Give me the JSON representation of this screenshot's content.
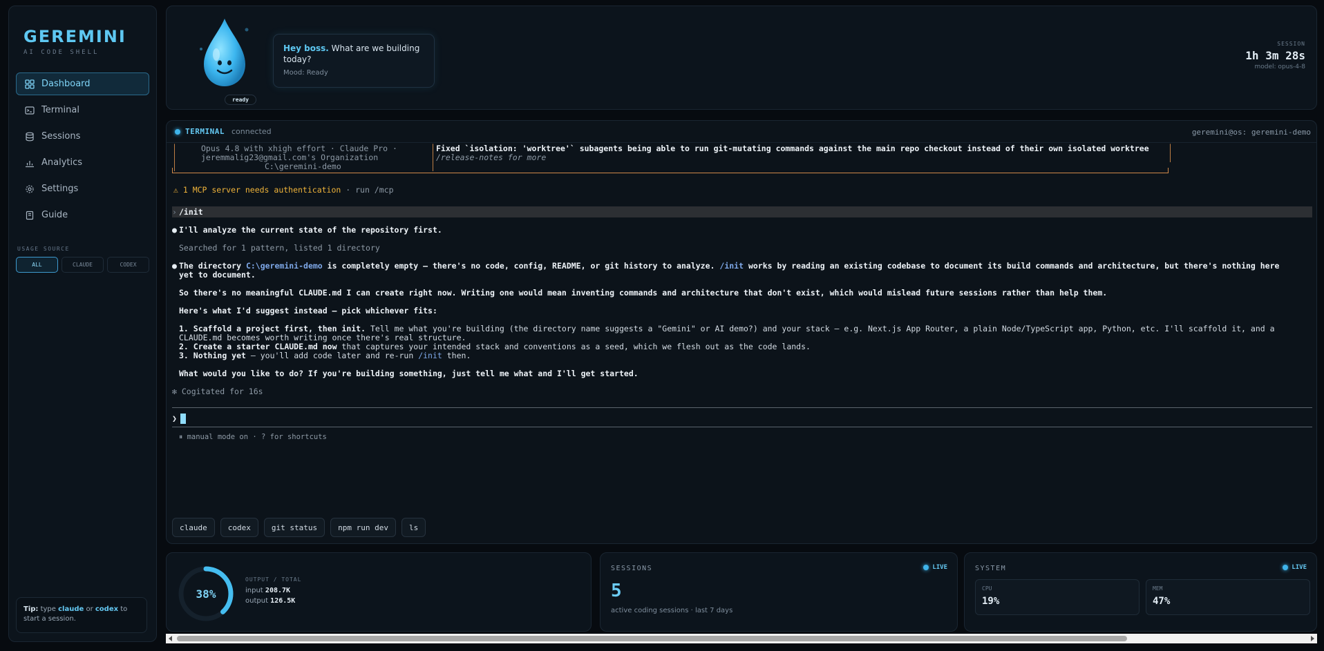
{
  "sidebar": {
    "brand": "GEREMINI",
    "brand_sub": "AI CODE SHELL",
    "items": [
      {
        "label": "Dashboard",
        "icon": "grid-icon",
        "active": true
      },
      {
        "label": "Terminal",
        "icon": "terminal-icon"
      },
      {
        "label": "Sessions",
        "icon": "database-icon"
      },
      {
        "label": "Analytics",
        "icon": "chart-icon"
      },
      {
        "label": "Settings",
        "icon": "gear-icon"
      },
      {
        "label": "Guide",
        "icon": "book-icon"
      }
    ],
    "usage_title": "USAGE SOURCE",
    "usage_options": [
      "ALL",
      "CLAUDE",
      "CODEX"
    ],
    "tip": {
      "prefix": "Tip:",
      "a": " type ",
      "k1": "claude",
      "b": " or ",
      "k2": "codex",
      "c": " to start a session."
    }
  },
  "hero": {
    "badge": "ready",
    "greeting_hi": "Hey boss.",
    "greeting_rest": " What are we building today?",
    "mood": "Mood: Ready",
    "session_label": "SESSION",
    "session_time": "1h 3m 28s",
    "model": "model: opus-4-8"
  },
  "terminal": {
    "title": "TERMINAL",
    "status": "connected",
    "user": "geremini@os: geremini-demo",
    "box_left_1": "Opus 4.8 with xhigh effort · Claude Pro ·",
    "box_left_2": "jeremmalig23@gmail.com's Organization",
    "box_left_3": "C:\\geremini-demo",
    "box_right_1": "Fixed `isolation: 'worktree'` subagents being able to run git-mutating commands against the main repo checkout instead of their own isolated worktree",
    "box_right_2": "/release-notes for more",
    "mcp_warn": "⚠ 1 MCP server needs authentication",
    "mcp_rest": " · run /mcp",
    "cmd": "/init",
    "line1": "I'll analyze the current state of the repository first.",
    "line2": "Searched for 1 pattern, listed 1 directory",
    "line3a": "The directory ",
    "line3b": "C:\\geremini-demo",
    "line3c": " is completely empty — there's no code, config, README, or git history to analyze. ",
    "line3d": "/init",
    "line3e": " works by reading an existing codebase to document its build commands and architecture, but there's nothing here",
    "line3f": "yet to document.",
    "line4": "So there's no meaningful CLAUDE.md I can create right now. Writing one would mean inventing commands and architecture that don't exist, which would mislead future sessions rather than help them.",
    "line5": "Here's what I'd suggest instead — pick whichever fits:",
    "opt1a": "1. ",
    "opt1b": "Scaffold a project first, then init.",
    "opt1c": " Tell me what you're building (the directory name suggests a \"Gemini\" or AI demo?) and your stack — e.g. Next.js App Router, a plain Node/TypeScript app, Python, etc. I'll scaffold it, and a",
    "opt1d": "CLAUDE.md becomes worth writing once there's real structure.",
    "opt2a": "2. ",
    "opt2b": "Create a starter CLAUDE.md now",
    "opt2c": " that captures your intended stack and conventions as a seed, which we flesh out as the code lands.",
    "opt3a": "3. ",
    "opt3b": "Nothing yet",
    "opt3c": " — you'll add code later and re-run ",
    "opt3d": "/init",
    "opt3e": " then.",
    "line6": "What would you like to do? If you're building something, just tell me what and I'll get started.",
    "cogitated": "✻ Cogitated for 16s",
    "prompt": "❯",
    "footer": "⏸ manual mode on · ? for shortcuts",
    "chips": [
      "claude",
      "codex",
      "git status",
      "npm run dev",
      "ls"
    ]
  },
  "cards": {
    "usage": {
      "percent": 38,
      "percent_label": "38%",
      "label": "OUTPUT / TOTAL",
      "input_label": "input",
      "input_value": "208.7K",
      "output_label": "output",
      "output_value": "126.5K"
    },
    "sessions": {
      "title": "SESSIONS",
      "live": "LIVE",
      "count": "5",
      "desc": "active coding sessions · last 7 days"
    },
    "system": {
      "title": "SYSTEM",
      "live": "LIVE",
      "cpu_label": "CPU",
      "cpu_value": "19%",
      "mem_label": "MEM",
      "mem_value": "47%"
    }
  },
  "colors": {
    "accent": "#5ec8f2",
    "background": "#070b10",
    "panel": "#0c141c",
    "warn": "#f0b43a",
    "border_orange": "#d28a4a"
  }
}
